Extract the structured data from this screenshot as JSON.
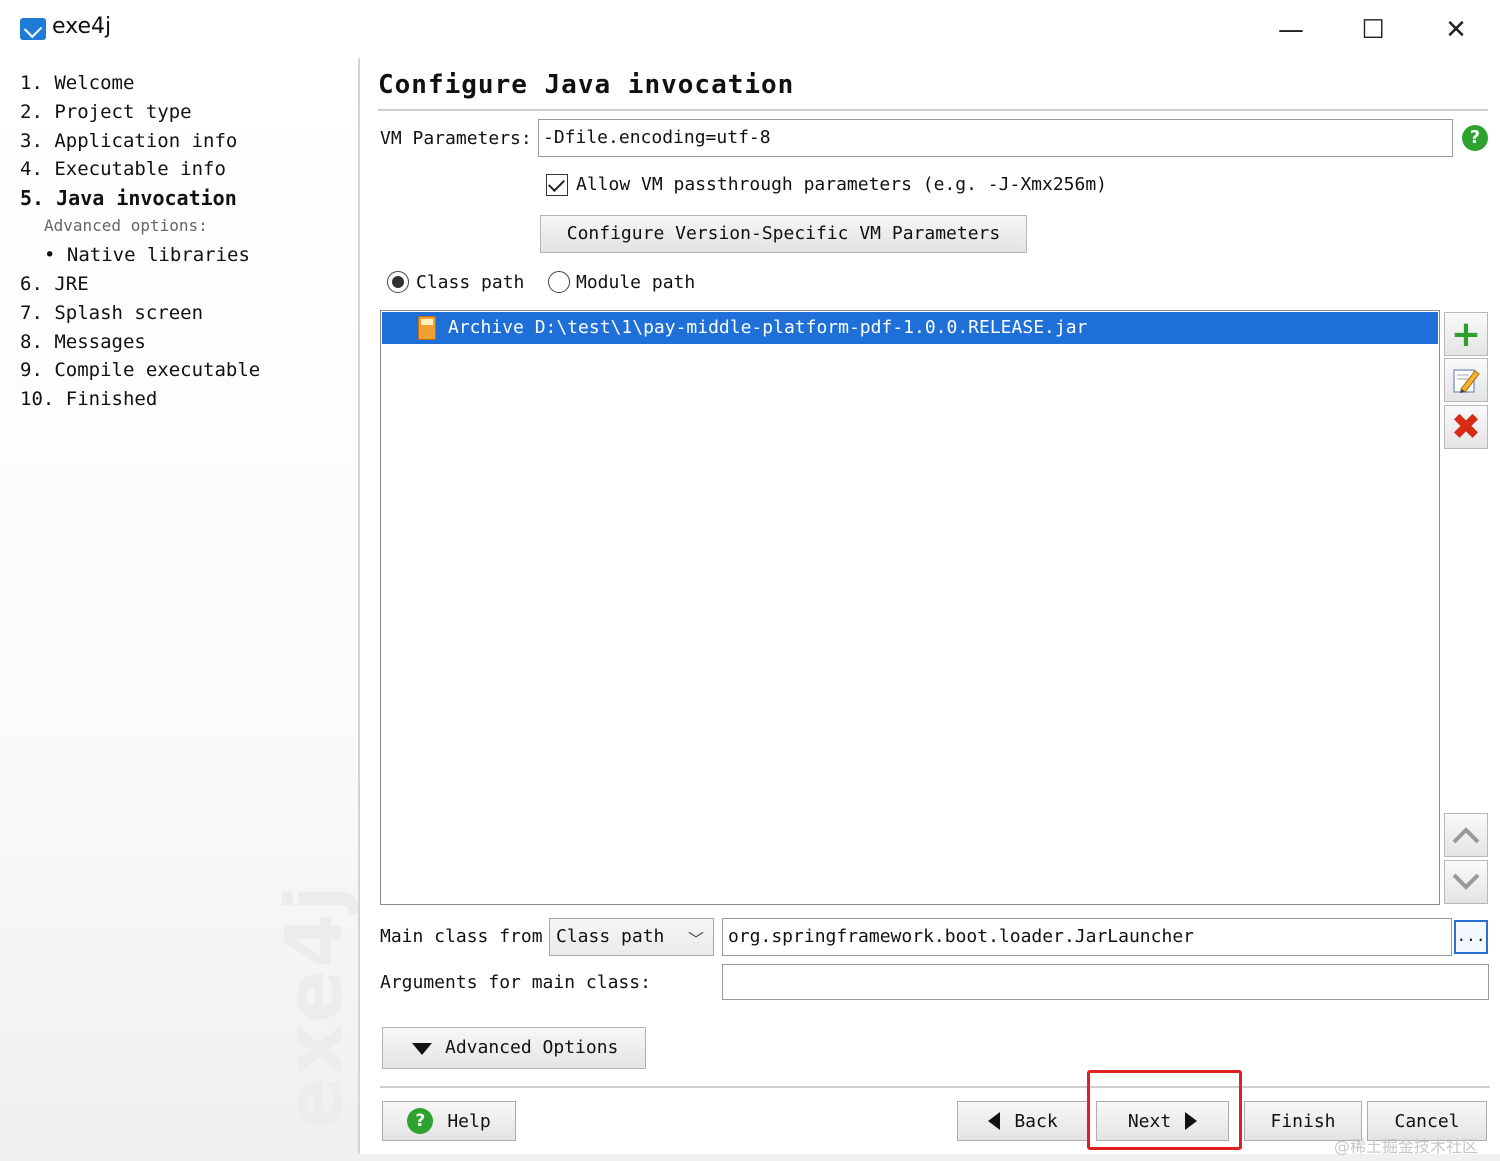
{
  "window": {
    "title": "exe4j",
    "minimize_glyph": "—",
    "maximize_glyph": "☐",
    "close_glyph": "✕"
  },
  "sidebar": {
    "steps": [
      {
        "label": "1.  Welcome"
      },
      {
        "label": "2.  Project type"
      },
      {
        "label": "3.  Application info"
      },
      {
        "label": "4.  Executable info"
      },
      {
        "label": "5.  Java invocation",
        "active": true
      },
      {
        "label": "6.  JRE"
      },
      {
        "label": "7.  Splash screen"
      },
      {
        "label": "8.  Messages"
      },
      {
        "label": "9.  Compile executable"
      },
      {
        "label": "10.  Finished"
      }
    ],
    "advanced_label": "Advanced options:",
    "native_libraries": "•  Native libraries",
    "watermark": "exe4j"
  },
  "main": {
    "title": "Configure Java invocation",
    "vm_parameters_label": "VM Parameters:",
    "vm_parameters_value": "-Dfile.encoding=utf-8",
    "allow_passthrough_label": "Allow VM passthrough parameters (e.g. -J-Xmx256m)",
    "allow_passthrough_checked": true,
    "configure_version_button": "Configure Version-Specific VM Parameters",
    "path_mode": {
      "class_path_label": "Class path",
      "module_path_label": "Module path",
      "selected": "Class path"
    },
    "classpath_entries": [
      {
        "text": "Archive D:\\test\\1\\pay-middle-platform-pdf-1.0.0.RELEASE.jar",
        "selected": true
      }
    ],
    "main_class_from_label": "Main class from",
    "main_class_from_value": "Class path",
    "main_class_value": "org.springframework.boot.loader.JarLauncher",
    "browse_glyph": "...",
    "arguments_label": "Arguments for main class:",
    "arguments_value": "",
    "advanced_options_button": "Advanced Options"
  },
  "footer": {
    "help": "Help",
    "back": "Back",
    "next": "Next",
    "finish": "Finish",
    "cancel": "Cancel",
    "credit": "@稀土掘金技术社区"
  },
  "colors": {
    "selection": "#1e6fd8",
    "highlight_box": "#e02020",
    "add_green": "#2f9e2f",
    "delete_red": "#d82b16"
  }
}
